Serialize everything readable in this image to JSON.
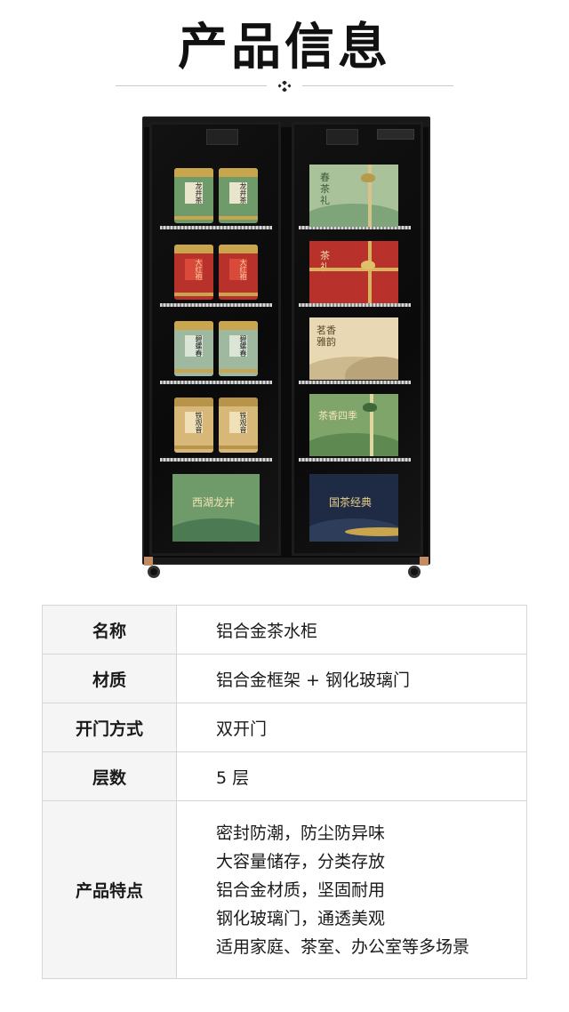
{
  "page_title": "产品信息",
  "product": {
    "cans": [
      {
        "label": "龙井茶"
      },
      {
        "label": "龙井茶"
      },
      {
        "label": "大红袍"
      },
      {
        "label": "大红袍"
      },
      {
        "label": "碧螺春"
      },
      {
        "label": "碧螺春"
      },
      {
        "label": "铁观音"
      },
      {
        "label": "铁观音"
      }
    ],
    "boxes": [
      {
        "label": "春茶礼"
      },
      {
        "label": "茶礼"
      },
      {
        "label": "茗香雅韵"
      },
      {
        "label": "茶香四季"
      },
      {
        "label": "西湖龙井"
      },
      {
        "label": "国茶经典"
      }
    ]
  },
  "specs": [
    {
      "key": "名称",
      "value": "铝合金茶水柜"
    },
    {
      "key": "材质",
      "value": "铝合金框架 + 钢化玻璃门"
    },
    {
      "key": "开门方式",
      "value": "双开门"
    },
    {
      "key": "层数",
      "value": "5 层"
    }
  ],
  "features": {
    "key": "产品特点",
    "items": [
      "密封防潮，防尘防异味",
      "大容量储存，分类存放",
      "铝合金材质，坚固耐用",
      "钢化玻璃门，通透美观",
      "适用家庭、茶室、办公室等多场景"
    ]
  },
  "colors": {
    "green_can": "#6f9a6a",
    "red_can": "#b8312a",
    "sage_can": "#9fb8a0",
    "gold_can": "#d8b878",
    "gold_cap": "#c9a64e",
    "navy_box": "#1f2a44"
  }
}
